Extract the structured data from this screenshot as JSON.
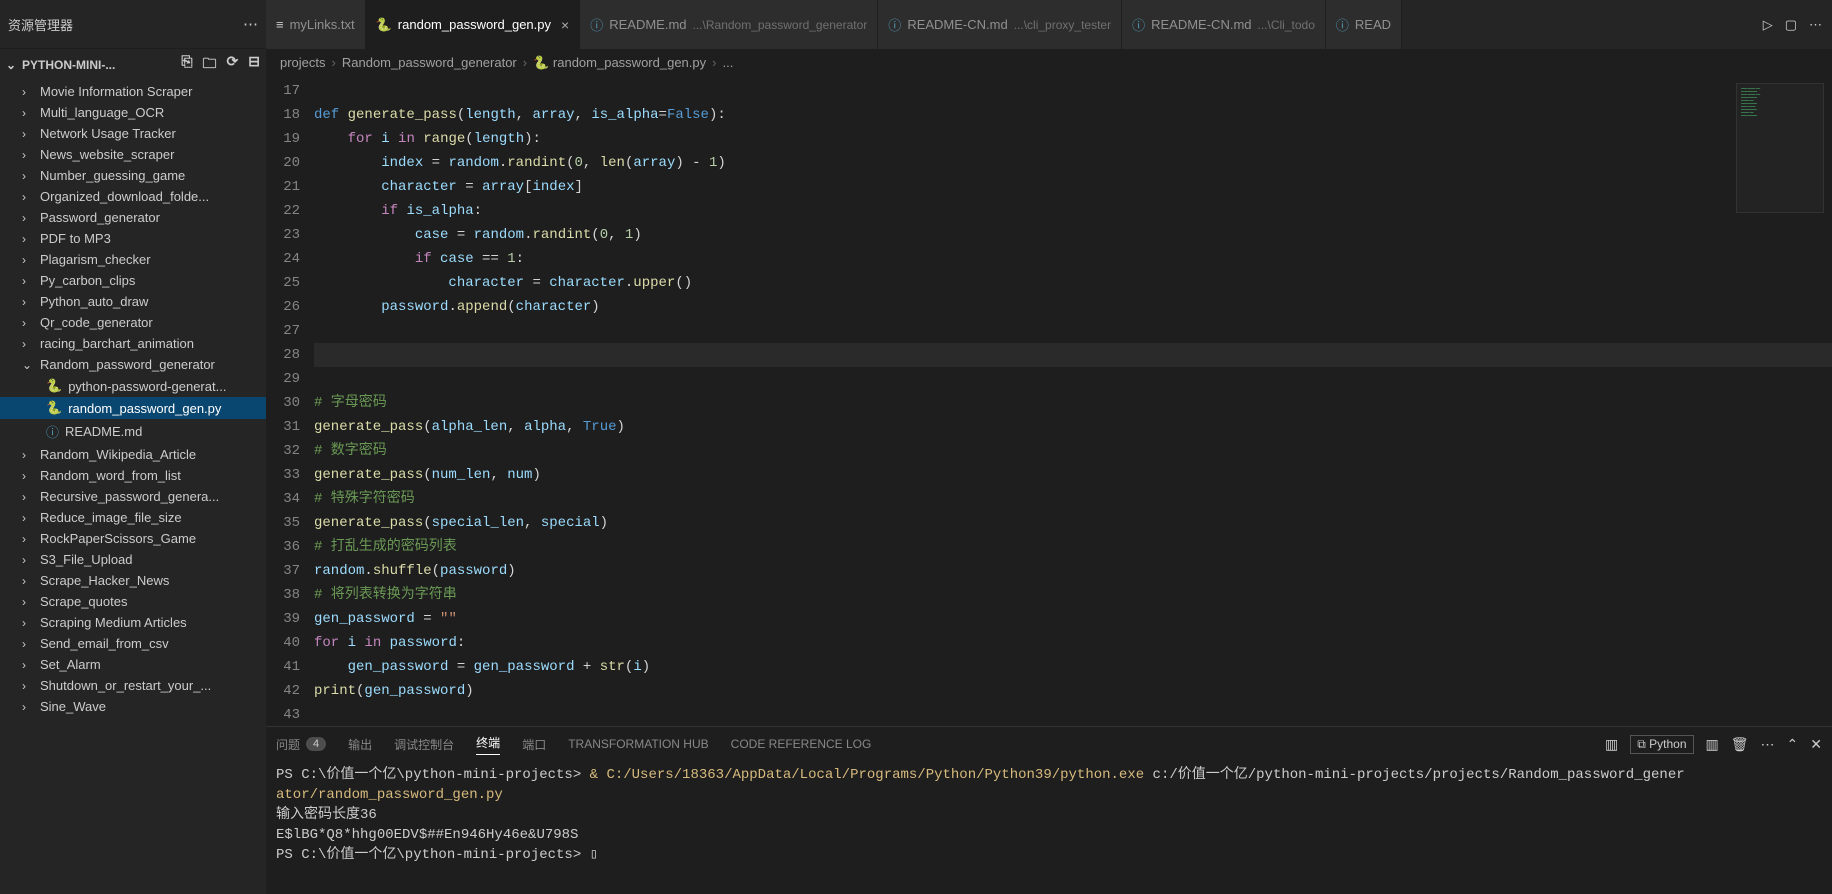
{
  "explorer": {
    "title": "资源管理器",
    "project": "PYTHON-MINI-...",
    "items": [
      {
        "label": "Movie Information Scraper",
        "type": "folder"
      },
      {
        "label": "Multi_language_OCR",
        "type": "folder"
      },
      {
        "label": "Network Usage Tracker",
        "type": "folder"
      },
      {
        "label": "News_website_scraper",
        "type": "folder"
      },
      {
        "label": "Number_guessing_game",
        "type": "folder"
      },
      {
        "label": "Organized_download_folde...",
        "type": "folder"
      },
      {
        "label": "Password_generator",
        "type": "folder"
      },
      {
        "label": "PDF to MP3",
        "type": "folder"
      },
      {
        "label": "Plagarism_checker",
        "type": "folder"
      },
      {
        "label": "Py_carbon_clips",
        "type": "folder"
      },
      {
        "label": "Python_auto_draw",
        "type": "folder"
      },
      {
        "label": "Qr_code_generator",
        "type": "folder"
      },
      {
        "label": "racing_barchart_animation",
        "type": "folder"
      },
      {
        "label": "Random_password_generator",
        "type": "folder",
        "expanded": true,
        "children": [
          {
            "label": "python-password-generat...",
            "type": "py"
          },
          {
            "label": "random_password_gen.py",
            "type": "py",
            "selected": true
          },
          {
            "label": "README.md",
            "type": "md"
          }
        ]
      },
      {
        "label": "Random_Wikipedia_Article",
        "type": "folder"
      },
      {
        "label": "Random_word_from_list",
        "type": "folder"
      },
      {
        "label": "Recursive_password_genera...",
        "type": "folder"
      },
      {
        "label": "Reduce_image_file_size",
        "type": "folder"
      },
      {
        "label": "RockPaperScissors_Game",
        "type": "folder"
      },
      {
        "label": "S3_File_Upload",
        "type": "folder"
      },
      {
        "label": "Scrape_Hacker_News",
        "type": "folder"
      },
      {
        "label": "Scrape_quotes",
        "type": "folder"
      },
      {
        "label": "Scraping Medium Articles",
        "type": "folder"
      },
      {
        "label": "Send_email_from_csv",
        "type": "folder"
      },
      {
        "label": "Set_Alarm",
        "type": "folder"
      },
      {
        "label": "Shutdown_or_restart_your_...",
        "type": "folder"
      },
      {
        "label": "Sine_Wave",
        "type": "folder"
      }
    ]
  },
  "tabs": [
    {
      "label": "myLinks.txt",
      "icon": "txt"
    },
    {
      "label": "random_password_gen.py",
      "icon": "py",
      "active": true,
      "close": true
    },
    {
      "label": "README.md",
      "dim": "...\\Random_password_generator",
      "icon": "md"
    },
    {
      "label": "README-CN.md",
      "dim": "...\\cli_proxy_tester",
      "icon": "md"
    },
    {
      "label": "README-CN.md",
      "dim": "...\\Cli_todo",
      "icon": "md"
    },
    {
      "label": "READ",
      "icon": "md"
    }
  ],
  "breadcrumb": [
    "projects",
    "Random_password_generator",
    "random_password_gen.py",
    "..."
  ],
  "code_start_line": 17,
  "code_lines_count": 27,
  "panel": {
    "tabs": [
      {
        "label": "问题",
        "badge": "4"
      },
      {
        "label": "输出"
      },
      {
        "label": "调试控制台"
      },
      {
        "label": "终端",
        "active": true
      },
      {
        "label": "端口"
      },
      {
        "label": "TRANSFORMATION HUB"
      },
      {
        "label": "CODE REFERENCE LOG"
      }
    ],
    "termtype": "Python"
  },
  "terminal": {
    "l1_a": "PS C:\\价值一个亿\\python-mini-projects> ",
    "l1_b": "& C:/Users/18363/AppData/Local/Programs/Python/Python39/python.exe",
    "l1_c": " c:/价值一个亿/python-mini-projects/projects/Random_password_gener",
    "l2": "ator/random_password_gen.py",
    "l3": "输入密码长度36",
    "l4": "E$lBG*Q8*hhg00EDV$##En946Hy46e&U798S",
    "l5": "PS C:\\价值一个亿\\python-mini-projects> ▯"
  },
  "glyphs": {
    "ellipsis": "⋯",
    "chev_right": "›",
    "chev_down": "⌄",
    "run": "▷",
    "split": "▢",
    "more": "⋯",
    "newfile": "⎘",
    "newfolder": "🗀",
    "refresh": "⟳",
    "collapse": "⊟",
    "panel_layout": "▥",
    "add": "+",
    "trash": "🗑",
    "up": "⌃",
    "close": "✕",
    "maximize": "▢"
  }
}
